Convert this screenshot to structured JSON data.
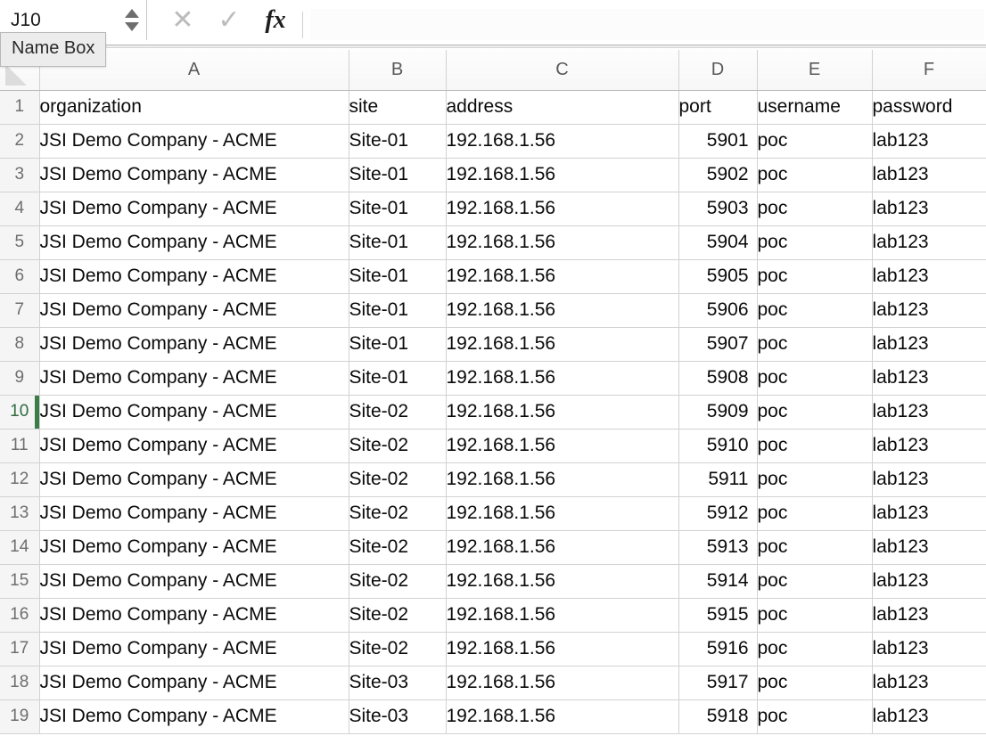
{
  "formula_bar": {
    "name_box_value": "J10",
    "name_box_tooltip": "Name Box",
    "cancel_icon": "✕",
    "accept_icon": "✓",
    "function_icon": "fx",
    "formula_value": ""
  },
  "grid": {
    "column_headers": [
      "A",
      "B",
      "C",
      "D",
      "E",
      "F"
    ],
    "active_row": 10,
    "accent_color": "#3a7d47",
    "row_numbers": [
      1,
      2,
      3,
      4,
      5,
      6,
      7,
      8,
      9,
      10,
      11,
      12,
      13,
      14,
      15,
      16,
      17,
      18,
      19
    ],
    "header_row": [
      "organization",
      "site",
      "address",
      "port",
      "username",
      "password"
    ],
    "rows": [
      [
        "JSI Demo Company - ACME",
        "Site-01",
        "192.168.1.56",
        "5901",
        "poc",
        "lab123"
      ],
      [
        "JSI Demo Company - ACME",
        "Site-01",
        "192.168.1.56",
        "5902",
        "poc",
        "lab123"
      ],
      [
        "JSI Demo Company - ACME",
        "Site-01",
        "192.168.1.56",
        "5903",
        "poc",
        "lab123"
      ],
      [
        "JSI Demo Company - ACME",
        "Site-01",
        "192.168.1.56",
        "5904",
        "poc",
        "lab123"
      ],
      [
        "JSI Demo Company - ACME",
        "Site-01",
        "192.168.1.56",
        "5905",
        "poc",
        "lab123"
      ],
      [
        "JSI Demo Company - ACME",
        "Site-01",
        "192.168.1.56",
        "5906",
        "poc",
        "lab123"
      ],
      [
        "JSI Demo Company - ACME",
        "Site-01",
        "192.168.1.56",
        "5907",
        "poc",
        "lab123"
      ],
      [
        "JSI Demo Company - ACME",
        "Site-01",
        "192.168.1.56",
        "5908",
        "poc",
        "lab123"
      ],
      [
        "JSI Demo Company - ACME",
        "Site-02",
        "192.168.1.56",
        "5909",
        "poc",
        "lab123"
      ],
      [
        "JSI Demo Company - ACME",
        "Site-02",
        "192.168.1.56",
        "5910",
        "poc",
        "lab123"
      ],
      [
        "JSI Demo Company - ACME",
        "Site-02",
        "192.168.1.56",
        "5911",
        "poc",
        "lab123"
      ],
      [
        "JSI Demo Company - ACME",
        "Site-02",
        "192.168.1.56",
        "5912",
        "poc",
        "lab123"
      ],
      [
        "JSI Demo Company - ACME",
        "Site-02",
        "192.168.1.56",
        "5913",
        "poc",
        "lab123"
      ],
      [
        "JSI Demo Company - ACME",
        "Site-02",
        "192.168.1.56",
        "5914",
        "poc",
        "lab123"
      ],
      [
        "JSI Demo Company - ACME",
        "Site-02",
        "192.168.1.56",
        "5915",
        "poc",
        "lab123"
      ],
      [
        "JSI Demo Company - ACME",
        "Site-02",
        "192.168.1.56",
        "5916",
        "poc",
        "lab123"
      ],
      [
        "JSI Demo Company - ACME",
        "Site-03",
        "192.168.1.56",
        "5917",
        "poc",
        "lab123"
      ],
      [
        "JSI Demo Company - ACME",
        "Site-03",
        "192.168.1.56",
        "5918",
        "poc",
        "lab123"
      ]
    ]
  }
}
